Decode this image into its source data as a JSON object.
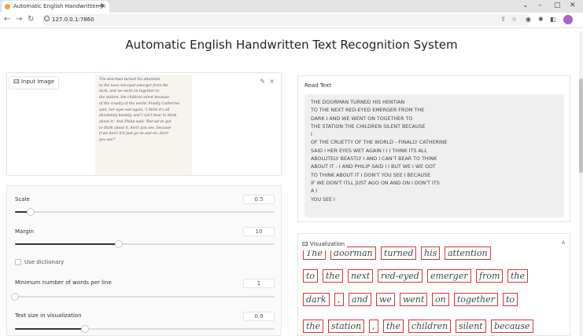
{
  "browser": {
    "tab_title": "Automatic English Handwritten T",
    "tab_close": "×",
    "new_tab": "+",
    "url": "127.0.0.1:7860"
  },
  "page": {
    "title": "Automatic English Handwritten Text Recognition System"
  },
  "input": {
    "label": "Input image",
    "edit_icon": "✎",
    "close_icon": "×",
    "handwriting_lines": [
      "The doorman turned his attention",
      "to the next red-eyed emerger from the",
      "dark, and we went on together to",
      "the station, the children silent because",
      "of the cruelty of the world. Finally Catherine",
      "said, her eyes wet again, 'I think it's all",
      "absolutely beastly, and I can't bear to think",
      "about it.' And Philip said: 'But we've got",
      "to think about it, don't you see, because",
      "if we don't it'll just go on and on, don't",
      "you see?'"
    ]
  },
  "controls": {
    "scale": {
      "label": "Scale",
      "value": "0.5",
      "fraction": 0.06
    },
    "margin": {
      "label": "Margin",
      "value": "10",
      "fraction": 0.4
    },
    "use_dictionary": {
      "label": "Use dictionary",
      "checked": false
    },
    "min_words": {
      "label": "Minimum number of words per line",
      "value": "1",
      "fraction": 0.0
    },
    "text_size": {
      "label": "Text size in visualization",
      "value": "0.9",
      "fraction": 0.27
    }
  },
  "read_text": {
    "label": "Read Text",
    "lines": [
      "THE DOORMAN TURNED HIS HENTIAN",
      "TO THE NEXT RED-EYED EMERGER FROM THE",
      "DARK I AND WE WENT ON TOGETHER TO",
      "THE STATION THE CHILDREN SILENT BECAUSE",
      "I",
      "OF THE CRUETTY OF THE WORLD - FINALLY CATHERINE",
      "SAID I HER EYES WET AGAIN I I I THINK ITS ALL",
      "ABOLUTELY BEASTLY I AND I CAN'T BEAR TO THINK",
      "ABOUT IT - I AND PHILIP SAID I I BUT WE I WE GOT",
      "TO THINK ABOUT IT I DON'T YOU SEE I BECAUSE",
      "IF WE DON'T ITLL JUST AGO ON AND ON I DON'T ITS",
      "A I",
      "YOU SEE I"
    ]
  },
  "visualization": {
    "label": "Visualization",
    "words": [
      "The",
      "doorman",
      "turned",
      "his",
      "attention",
      "to",
      "the",
      "next",
      "red-eyed",
      "emerger",
      "from",
      "the",
      "dark",
      ",",
      "and",
      "we",
      "went",
      "on",
      "together",
      "to",
      "the",
      "station",
      ",",
      "the",
      "children",
      "silent",
      "because"
    ]
  },
  "colors": {
    "box_border": "#dd3333",
    "slider_fill": "#333333"
  }
}
